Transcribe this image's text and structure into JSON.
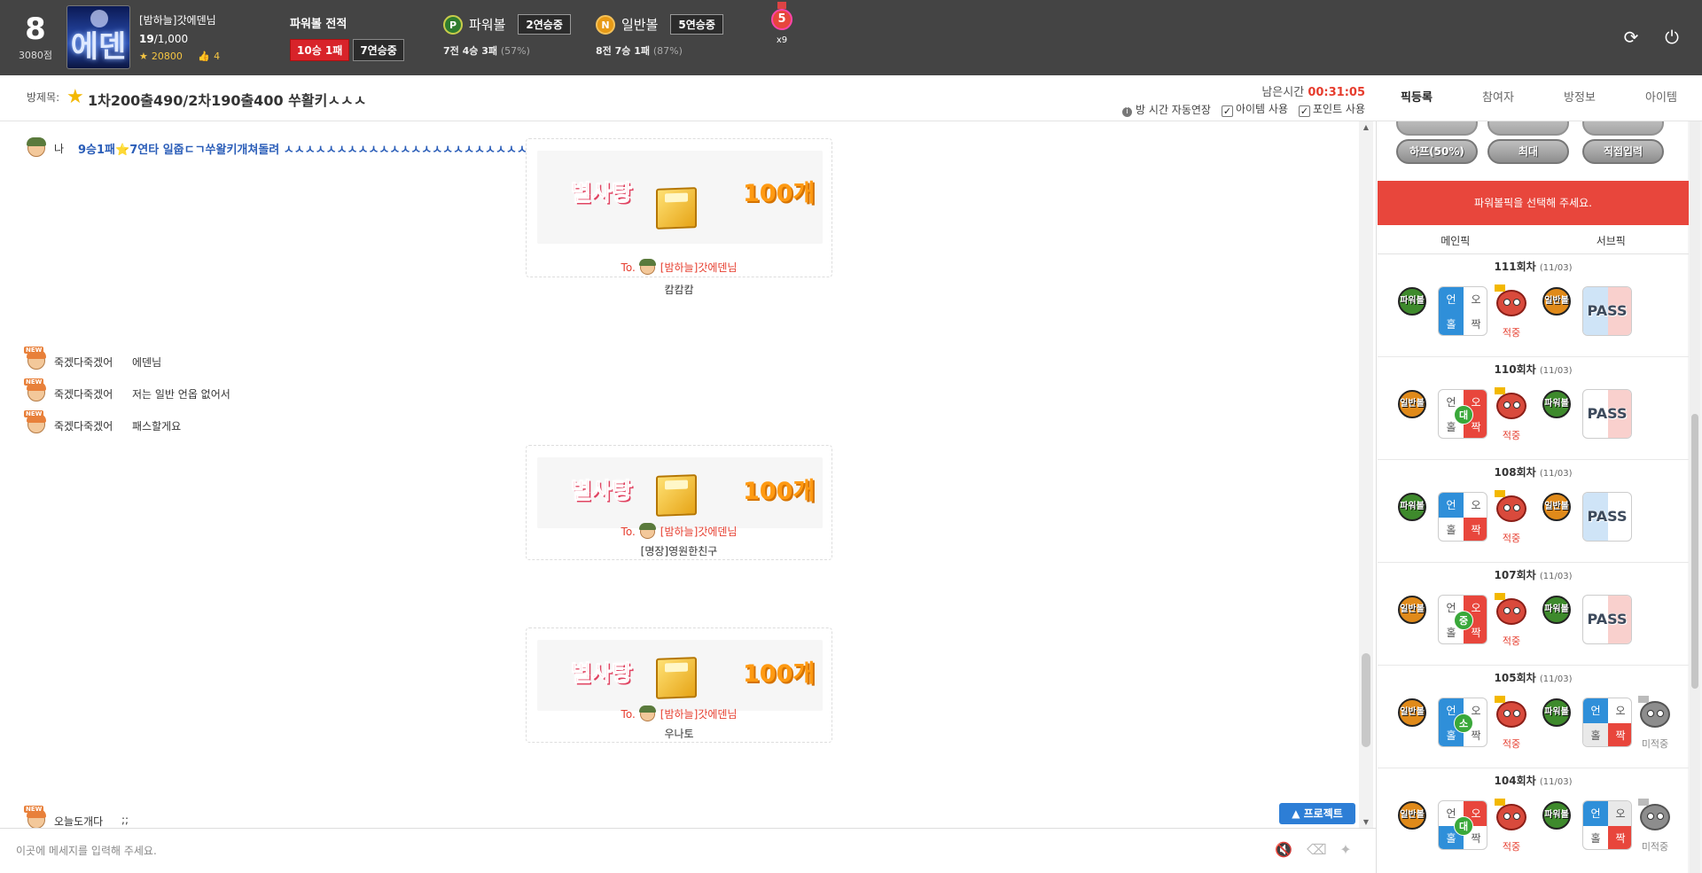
{
  "header": {
    "level": "8",
    "points": "3080점",
    "avatar_glyph": "에덴",
    "username": "[밤하늘]갓에덴님",
    "count_current": "19",
    "count_total": "/1,000",
    "stars": "20800",
    "likes": "4",
    "record_title": "파워볼 전적",
    "record_wins": "10승 1패",
    "record_streak": "7연승중",
    "powerball": {
      "icon_letter": "P",
      "label": "파워볼",
      "streak": "2연승중",
      "summary": "7전 4승 3패",
      "pct": "(57%)"
    },
    "normalball": {
      "icon_letter": "N",
      "label": "일반볼",
      "streak": "5연승중",
      "summary": "8전 7승 1패",
      "pct": "(87%)"
    },
    "medal_number": "5",
    "medal_mult": "x9",
    "refresh_icon": "refresh-icon",
    "power_icon": "power-icon"
  },
  "room": {
    "label": "방제목:",
    "title": "1차200출490/2차190출400 쑤활키ㅅㅅㅅ",
    "remain_label": "남은시간",
    "remain_time": "00:31:05",
    "auto_extend": "방 시간 자동연장",
    "use_item": "아이템 사용",
    "use_point": "포인트 사용"
  },
  "tabs": [
    "픽등록",
    "참여자",
    "방정보",
    "아이템"
  ],
  "chat": {
    "messages": [
      {
        "who": "나",
        "text": "9승1패⭐7연타 일줍ㄷㄱ쑤왈키개쳐돌려 ㅅㅅㅅㅅㅅㅅㅅㅅㅅㅅㅅㅅㅅㅅㅅㅅㅅㅅㅅㅅㅅㅅㅅㅅㅅㅅㅅㅅㅅㅅㅅㅅㅅㅅㅅㅅ"
      },
      {
        "who": "죽겠다죽겠어",
        "text": "에덴님"
      },
      {
        "who": "죽겠다죽겠어",
        "text": "저는 일반 언옵 없어서"
      },
      {
        "who": "죽겠다죽겠어",
        "text": "패스할게요"
      },
      {
        "who": "오늘도개다",
        "text": ";;"
      }
    ],
    "gifts": [
      {
        "candy": "별사탕",
        "count": "100개",
        "to": "To.",
        "recipient": "[밤하늘]갓에덴님",
        "sender": "캄캄캄"
      },
      {
        "candy": "별사탕",
        "count": "100개",
        "to": "To.",
        "recipient": "[밤하늘]갓에덴님",
        "sender": "[명장]영원한친구"
      },
      {
        "candy": "별사탕",
        "count": "100개",
        "to": "To.",
        "recipient": "[밤하늘]갓에덴님",
        "sender": "우나토"
      }
    ],
    "protect_button": "▲ 프로젝트",
    "input_placeholder": "이곳에 메세지를 입력해 주세요."
  },
  "panel": {
    "buttons": [
      "하프(50%)",
      "최대",
      "직접입력"
    ],
    "alert": "파워볼픽을 선택해 주세요.",
    "main_pick": "메인픽",
    "sub_pick": "서브픽",
    "ball_power": "파워볼",
    "ball_normal": "일반볼",
    "cell_labels": {
      "un": "언",
      "o": "오",
      "hol": "홀",
      "jjak": "짝"
    },
    "pass_text": "PASS",
    "rounds": [
      {
        "title": "111회차",
        "date": "(11/03)",
        "main_ball": "파워볼",
        "main_status": "적중",
        "sub_ball": "일반볼",
        "sub_status": ""
      },
      {
        "title": "110회차",
        "date": "(11/03)",
        "main_ball": "일반볼",
        "main_mid": "대",
        "main_status": "적중",
        "sub_ball": "파워볼",
        "sub_status": ""
      },
      {
        "title": "108회차",
        "date": "(11/03)",
        "main_ball": "파워볼",
        "main_status": "적중",
        "sub_ball": "일반볼",
        "sub_status": ""
      },
      {
        "title": "107회차",
        "date": "(11/03)",
        "main_ball": "일반볼",
        "main_mid": "중",
        "main_status": "적중",
        "sub_ball": "파워볼",
        "sub_status": ""
      },
      {
        "title": "105회차",
        "date": "(11/03)",
        "main_ball": "일반볼",
        "main_mid": "소",
        "main_status": "적중",
        "sub_ball": "파워볼",
        "sub_status": "미적중"
      },
      {
        "title": "104회차",
        "date": "(11/03)",
        "main_ball": "일반볼",
        "main_mid": "대",
        "main_status": "적중",
        "sub_ball": "파워볼",
        "sub_status": "미적중"
      }
    ]
  },
  "colors": {
    "header_bg": "#444444",
    "accent_red": "#e8463c",
    "accent_blue": "#2f8fd9",
    "power_green": "#3e8a2c",
    "normal_orange": "#e08a1a"
  }
}
